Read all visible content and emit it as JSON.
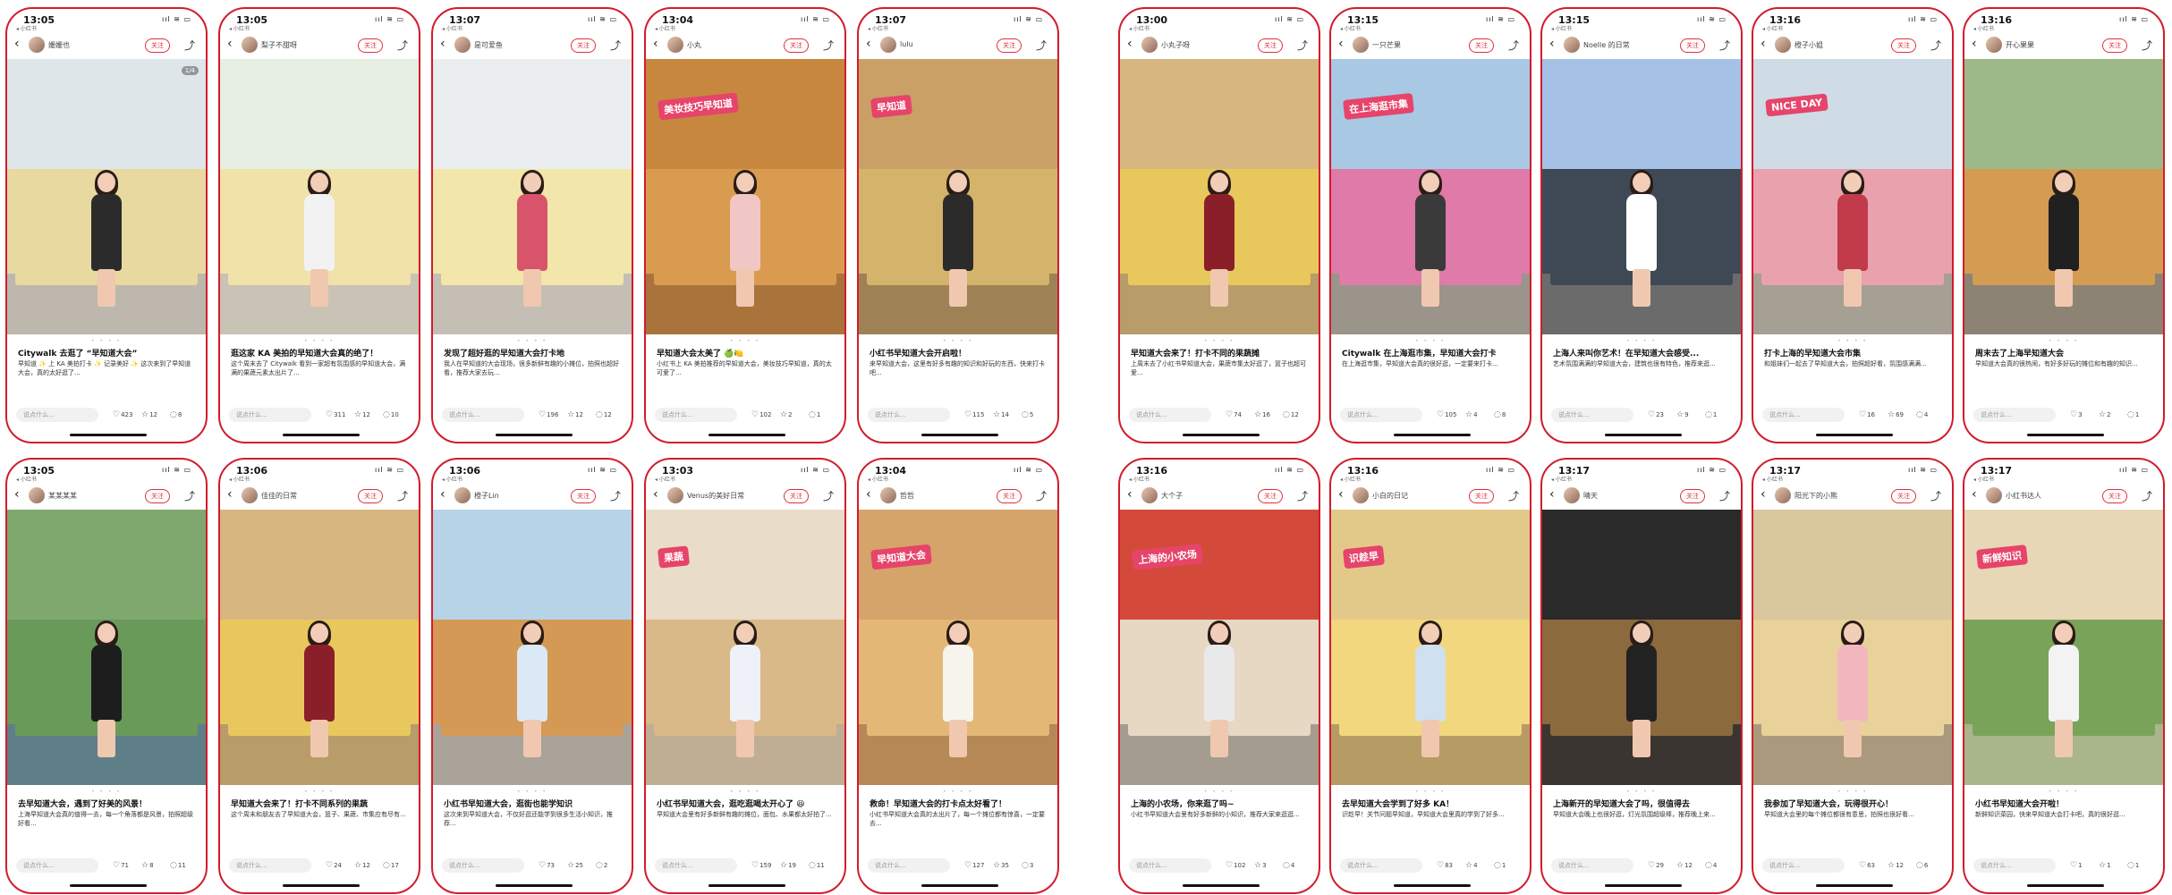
{
  "common": {
    "back": "‹",
    "share": "⤴",
    "follow": "关注",
    "comment_placeholder": "说点什么...",
    "status_sub": "◂ 小红书",
    "status_icons": "ııl ≋ ▭",
    "dots": "• • • •"
  },
  "left_group": {
    "rows": [
      [
        {
          "time": "13:05",
          "user": "姗姗也",
          "title": "Citywalk 去逛了 “早知道大会”",
          "body": "早知道 ✨ 上 KA 美拍打卡 ✨ 记录美好 ✨ 这次来到了早知道大会，真的太好逛了...",
          "likes": "423",
          "stars": "12",
          "comments": "8",
          "badge": "1/4",
          "palette": "a",
          "sign": ""
        },
        {
          "time": "13:05",
          "user": "梨子不甜呀",
          "title": "逛这家 KA 美拍的早知道大会真的绝了！",
          "body": "这个周末去了 Citywalk 看到一家超有氛围感的早知道大会，满满的果蔬元素太出片了...",
          "likes": "311",
          "stars": "12",
          "comments": "10",
          "badge": "",
          "palette": "b",
          "sign": ""
        },
        {
          "time": "13:07",
          "user": "是可爱鱼",
          "title": "发现了超好逛的早知道大会打卡地",
          "body": "我人在早知道的大会现场，很多新鲜有趣的小摊位，拍照也超好看，推荐大家去玩...",
          "likes": "196",
          "stars": "12",
          "comments": "12",
          "badge": "",
          "palette": "c",
          "sign": ""
        },
        {
          "time": "13:04",
          "user": "小丸",
          "title": "早知道大会太美了 🍏🍋",
          "body": "小红书上 KA 美拍推荐的早知道大会，美妆技巧早知道，真的太可爱了...",
          "likes": "102",
          "stars": "2",
          "comments": "1",
          "badge": "",
          "palette": "d",
          "sign": "美妆技巧早知道"
        },
        {
          "time": "13:07",
          "user": "lulu",
          "title": "小红书早知道大会开启啦！",
          "body": "来早知道大会，这里有好多有趣的知识和好玩的东西，快来打卡吧...",
          "likes": "115",
          "stars": "14",
          "comments": "5",
          "badge": "",
          "palette": "e",
          "sign": "早知道"
        }
      ],
      [
        {
          "time": "13:05",
          "user": "某某某某",
          "title": "去早知道大会，遇到了好美的风景！",
          "body": "上海早知道大会真的值得一去，每一个角落都是风景，拍照超级好看...",
          "likes": "71",
          "stars": "8",
          "comments": "11",
          "badge": "",
          "palette": "f",
          "sign": ""
        },
        {
          "time": "13:06",
          "user": "佳佳的日常",
          "title": "早知道大会来了！打卡不同系列的果蔬",
          "body": "这个周末和朋友去了早知道大会，篮子、果蔬、市集应有尽有...",
          "likes": "24",
          "stars": "12",
          "comments": "17",
          "badge": "",
          "palette": "g",
          "sign": ""
        },
        {
          "time": "13:06",
          "user": "橙子Lin",
          "title": "小红书早知道大会，逛街也能学知识",
          "body": "这次来到早知道大会，不仅好逛还能学到很多生活小知识，推荐...",
          "likes": "73",
          "stars": "25",
          "comments": "2",
          "badge": "",
          "palette": "h",
          "sign": ""
        },
        {
          "time": "13:03",
          "user": "Venus的美好日常",
          "title": "小红书早知道大会，逛吃逛喝太开心了 😆",
          "body": "早知道大会里有好多新鲜有趣的摊位，面包、水果都太好拍了...",
          "likes": "159",
          "stars": "19",
          "comments": "11",
          "badge": "",
          "palette": "i",
          "sign": "果蔬"
        },
        {
          "time": "13:04",
          "user": "哲哲",
          "title": "救命！早知道大会的打卡点太好看了！",
          "body": "小红书早知道大会真的太出片了，每一个摊位都有惊喜，一定要去...",
          "likes": "127",
          "stars": "35",
          "comments": "3",
          "badge": "",
          "palette": "j",
          "sign": "早知道大会"
        }
      ]
    ]
  },
  "right_group": {
    "rows": [
      [
        {
          "time": "13:00",
          "user": "小丸子呀",
          "title": "早知道大会来了！打卡不同的果蔬摊",
          "body": "上周末去了小红书早知道大会，果蔬市集太好逛了，篮子也超可爱...",
          "likes": "74",
          "stars": "16",
          "comments": "12",
          "badge": "",
          "palette": "g",
          "sign": ""
        },
        {
          "time": "13:15",
          "user": "一只芒果",
          "title": "Citywalk 在上海逛市集，早知道大会打卡",
          "body": "在上海逛市集，早知道大会真的很好逛，一定要来打卡...",
          "likes": "105",
          "stars": "4",
          "comments": "8",
          "badge": "",
          "palette": "k",
          "sign": "在上海逛市集"
        },
        {
          "time": "13:15",
          "user": "Noelle 的日常",
          "title": "上海人来叫你艺术！在早知道大会感受...",
          "body": "艺术氛围满满的早知道大会，建筑也很有特色，推荐来逛...",
          "likes": "23",
          "stars": "9",
          "comments": "1",
          "badge": "",
          "palette": "l",
          "sign": ""
        },
        {
          "time": "13:16",
          "user": "橙子小姐",
          "title": "打卡上海的早知道大会市集",
          "body": "和姐妹们一起去了早知道大会，拍照超好看，氛围感满满...",
          "likes": "16",
          "stars": "69",
          "comments": "4",
          "badge": "",
          "palette": "m",
          "sign": "NICE DAY"
        },
        {
          "time": "13:16",
          "user": "开心果果",
          "title": "周末去了上海早知道大会",
          "body": "早知道大会真的很热闹，有好多好玩的摊位和有趣的知识...",
          "likes": "3",
          "stars": "2",
          "comments": "1",
          "badge": "",
          "palette": "n",
          "sign": ""
        }
      ],
      [
        {
          "time": "13:16",
          "user": "大个子",
          "title": "上海的小农场，你来逛了吗~",
          "body": "小红书早知道大会里有好多新鲜的小知识，推荐大家来逛逛...",
          "likes": "102",
          "stars": "3",
          "comments": "4",
          "badge": "",
          "palette": "o",
          "sign": "上海的小农场"
        },
        {
          "time": "13:16",
          "user": "小白的日记",
          "title": "去早知道大会学到了好多 KA！",
          "body": "识趁早！关节问题早知道，早知道大会里真的学到了好多...",
          "likes": "83",
          "stars": "4",
          "comments": "1",
          "badge": "",
          "palette": "p",
          "sign": "识趁早"
        },
        {
          "time": "13:17",
          "user": "晴天",
          "title": "上海新开的早知道大会了吗，很值得去",
          "body": "早知道大会晚上也很好逛，灯光氛围超级棒，推荐晚上来...",
          "likes": "29",
          "stars": "12",
          "comments": "4",
          "badge": "",
          "palette": "q",
          "sign": ""
        },
        {
          "time": "13:17",
          "user": "阳光下的小熊",
          "title": "我参加了早知道大会，玩得很开心！",
          "body": "早知道大会里的每个摊位都很有意思，拍照也很好看...",
          "likes": "63",
          "stars": "12",
          "comments": "6",
          "badge": "",
          "palette": "r",
          "sign": ""
        },
        {
          "time": "13:17",
          "user": "小红书达人",
          "title": "小红书早知道大会开啦！",
          "body": "新鲜知识菜园，快来早知道大会打卡吧，真的很好逛...",
          "likes": "1",
          "stars": "1",
          "comments": "1",
          "badge": "",
          "palette": "s",
          "sign": "新鲜知识"
        }
      ]
    ]
  },
  "palettes": {
    "a": {
      "sky": "#dfe6ea",
      "ground": "#bdb7ad",
      "stall": "#e8d9a0",
      "body": "#2b2b2b"
    },
    "b": {
      "sky": "#e6efe2",
      "ground": "#c9c3b6",
      "stall": "#f0e2a8",
      "body": "#f2f2f2"
    },
    "c": {
      "sky": "#eaeef0",
      "ground": "#c4beb4",
      "stall": "#f2e6aa",
      "body": "#d8546a"
    },
    "d": {
      "sky": "#c8873f",
      "ground": "#a9743c",
      "stall": "#d99b4f",
      "body": "#f1c7c5"
    },
    "e": {
      "sky": "#caa067",
      "ground": "#9f8156",
      "stall": "#d4b36b",
      "body": "#2b2b2b"
    },
    "f": {
      "sky": "#7ea86d",
      "ground": "#5f7f88",
      "stall": "#6a9a5a",
      "body": "#1d1d1d"
    },
    "g": {
      "sky": "#d7b680",
      "ground": "#b89c6a",
      "stall": "#e8c85c",
      "body": "#8a1f2a"
    },
    "h": {
      "sky": "#b7d3e8",
      "ground": "#a9a39a",
      "stall": "#d49a55",
      "body": "#dbe8f5"
    },
    "i": {
      "sky": "#e9dcc8",
      "ground": "#bfae93",
      "stall": "#d9b987",
      "body": "#eef2f8"
    },
    "j": {
      "sky": "#d4a46a",
      "ground": "#b58856",
      "stall": "#e3b877",
      "body": "#f7f4ee"
    },
    "k": {
      "sky": "#a8c8e4",
      "ground": "#9a948a",
      "stall": "#e07aa8",
      "body": "#3a3a3a"
    },
    "l": {
      "sky": "#a5c2e6",
      "ground": "#6b6b6b",
      "stall": "#3e4955",
      "body": "#ffffff"
    },
    "m": {
      "sky": "#cfdce6",
      "ground": "#a69f94",
      "stall": "#e8a1ad",
      "body": "#c23b4a"
    },
    "n": {
      "sky": "#9db98a",
      "ground": "#8d8375",
      "stall": "#d39c52",
      "body": "#202020"
    },
    "o": {
      "sky": "#d44a3a",
      "ground": "#a59c90",
      "stall": "#e6d8c3",
      "body": "#e9e9e9"
    },
    "p": {
      "sky": "#e3c989",
      "ground": "#b79b64",
      "stall": "#f2d77e",
      "body": "#cfe0f0"
    },
    "q": {
      "sky": "#2a2a2a",
      "ground": "#3a3530",
      "stall": "#8b6a3e",
      "body": "#222222"
    },
    "r": {
      "sky": "#d9c79d",
      "ground": "#a99a7d",
      "stall": "#e8d29a",
      "body": "#f2b6bf"
    },
    "s": {
      "sky": "#e7d7b6",
      "ground": "#a9b58a",
      "stall": "#7aa35a",
      "body": "#f3f3f3"
    }
  }
}
